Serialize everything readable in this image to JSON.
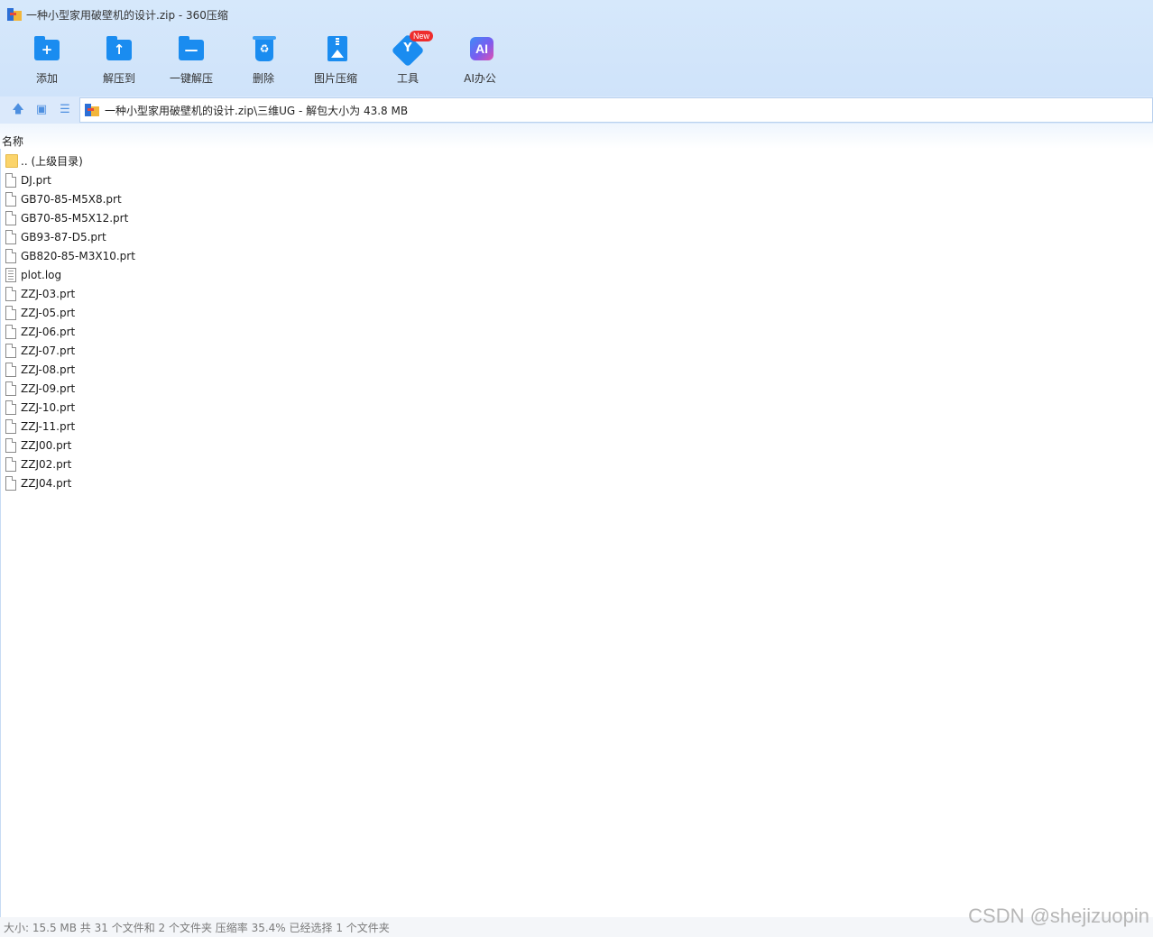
{
  "window": {
    "title": "一种小型家用破壁机的设计.zip - 360压缩"
  },
  "toolbar": {
    "items": [
      {
        "label": "添加",
        "icon": "add-folder-icon"
      },
      {
        "label": "解压到",
        "icon": "extract-to-icon"
      },
      {
        "label": "一键解压",
        "icon": "one-click-extract-icon"
      },
      {
        "label": "删除",
        "icon": "delete-icon"
      },
      {
        "label": "图片压缩",
        "icon": "image-compress-icon"
      },
      {
        "label": "工具",
        "icon": "tools-icon",
        "badge": "New"
      },
      {
        "label": "AI办公",
        "icon": "ai-office-icon",
        "glyph": "AI"
      }
    ]
  },
  "nav": {
    "address": "一种小型家用破壁机的设计.zip\\三维UG - 解包大小为 43.8 MB"
  },
  "list": {
    "column_name": "名称",
    "files": [
      {
        "name": ".. (上级目录)",
        "type": "parent"
      },
      {
        "name": "DJ.prt",
        "type": "file"
      },
      {
        "name": "GB70-85-M5X8.prt",
        "type": "file"
      },
      {
        "name": "GB70-85-M5X12.prt",
        "type": "file"
      },
      {
        "name": "GB93-87-D5.prt",
        "type": "file"
      },
      {
        "name": "GB820-85-M3X10.prt",
        "type": "file"
      },
      {
        "name": "plot.log",
        "type": "log"
      },
      {
        "name": "ZZJ-03.prt",
        "type": "file"
      },
      {
        "name": "ZZJ-05.prt",
        "type": "file"
      },
      {
        "name": "ZZJ-06.prt",
        "type": "file"
      },
      {
        "name": "ZZJ-07.prt",
        "type": "file"
      },
      {
        "name": "ZZJ-08.prt",
        "type": "file"
      },
      {
        "name": "ZZJ-09.prt",
        "type": "file"
      },
      {
        "name": "ZZJ-10.prt",
        "type": "file"
      },
      {
        "name": "ZZJ-11.prt",
        "type": "file"
      },
      {
        "name": "ZZJ00.prt",
        "type": "file"
      },
      {
        "name": "ZZJ02.prt",
        "type": "file"
      },
      {
        "name": "ZZJ04.prt",
        "type": "file"
      }
    ]
  },
  "status": {
    "text": "大小: 15.5 MB 共 31 个文件和 2 个文件夹 压缩率 35.4% 已经选择 1 个文件夹"
  },
  "watermark": "CSDN @shejizuopin",
  "colors": {
    "toolbar_bg": "#d6e8fb",
    "icon_blue": "#1a8cf0",
    "badge_red": "#ee2d2d"
  }
}
